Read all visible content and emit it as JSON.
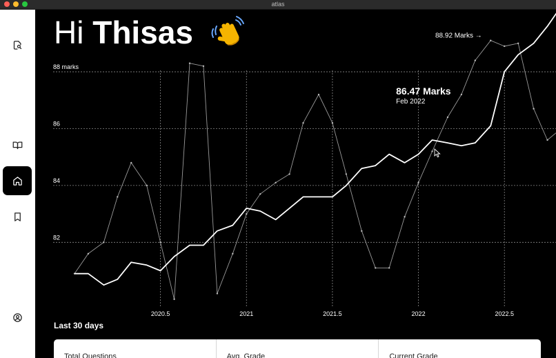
{
  "window": {
    "title": "atlas"
  },
  "sidebar": {
    "items": [
      {
        "icon": "search-document-icon",
        "active": false
      },
      {
        "icon": "book-icon",
        "active": false
      },
      {
        "icon": "home-icon",
        "active": true
      },
      {
        "icon": "bookmark-icon",
        "active": false
      },
      {
        "icon": "user-circle-icon",
        "active": false
      }
    ]
  },
  "header": {
    "greeting": "Hi",
    "name": "Thisas",
    "emoji_icon": "waving-hand-icon"
  },
  "chart_data": {
    "type": "line",
    "x_ticks": [
      2020.5,
      2021,
      2021.5,
      2022,
      2022.5
    ],
    "x_tick_labels": [
      "2020.5",
      "2021",
      "2021.5",
      "2022",
      "2022.5"
    ],
    "y_ticks": [
      82,
      84,
      86,
      88
    ],
    "y_tick_labels": [
      "82",
      "84",
      "86",
      "88 marks"
    ],
    "xlim": [
      2019.96,
      2022.8
    ],
    "ylim": [
      79.8,
      89.7
    ],
    "grid": true,
    "series": [
      {
        "values_x": [
          2020.0,
          2020.08,
          2020.17,
          2020.25,
          2020.33,
          2020.42,
          2020.5,
          2020.58,
          2020.67,
          2020.75,
          2020.83,
          2020.92,
          2021.0,
          2021.08,
          2021.17,
          2021.25,
          2021.33,
          2021.42,
          2021.5,
          2021.58,
          2021.67,
          2021.75,
          2021.83,
          2021.92,
          2022.0,
          2022.08,
          2022.17,
          2022.25,
          2022.33,
          2022.42,
          2022.5,
          2022.58,
          2022.67,
          2022.75,
          2022.83
        ],
        "values_y": [
          80.9,
          80.9,
          80.5,
          80.7,
          81.3,
          81.2,
          81.0,
          81.5,
          81.9,
          81.9,
          82.4,
          82.6,
          83.2,
          83.1,
          82.8,
          83.2,
          83.6,
          83.6,
          83.6,
          84.0,
          84.6,
          84.7,
          85.1,
          84.8,
          85.1,
          85.6,
          85.5,
          85.4,
          85.5,
          86.1,
          88.0,
          88.6,
          89.0,
          89.6,
          90.3
        ]
      },
      {
        "values_x": [
          2020.0,
          2020.08,
          2020.17,
          2020.25,
          2020.33,
          2020.42,
          2020.5,
          2020.58,
          2020.67,
          2020.75,
          2020.83,
          2020.92,
          2021.0,
          2021.08,
          2021.17,
          2021.25,
          2021.33,
          2021.42,
          2021.5,
          2021.58,
          2021.67,
          2021.75,
          2021.83,
          2021.92,
          2022.0,
          2022.08,
          2022.17,
          2022.25,
          2022.33,
          2022.42,
          2022.5,
          2022.58,
          2022.67,
          2022.75,
          2022.83
        ],
        "values_y": [
          80.9,
          81.6,
          82.0,
          83.6,
          84.8,
          84.0,
          82.0,
          80.0,
          88.3,
          88.2,
          80.2,
          81.6,
          83.0,
          83.7,
          84.1,
          84.4,
          86.2,
          87.2,
          86.2,
          84.4,
          82.4,
          81.1,
          81.1,
          82.9,
          84.1,
          85.2,
          86.4,
          87.2,
          88.4,
          89.1,
          88.9,
          89.0,
          86.7,
          85.6,
          86.0
        ]
      }
    ],
    "annotations": [
      {
        "text": "88.92 Marks →",
        "x": 2022.37,
        "y": 89.2
      }
    ],
    "tooltip": {
      "value": "86.47 Marks",
      "date": "Feb 2022",
      "x": 2021.87,
      "y": 87.2
    }
  },
  "summary": {
    "title": "Last 30 days",
    "stats": [
      {
        "label": "Total Questions"
      },
      {
        "label": "Avg. Grade"
      },
      {
        "label": "Current Grade"
      }
    ]
  },
  "colors": {
    "accent": "#ffffff",
    "background": "#000000",
    "sidebar": "#ffffff",
    "grid": "#8a8a8a"
  }
}
